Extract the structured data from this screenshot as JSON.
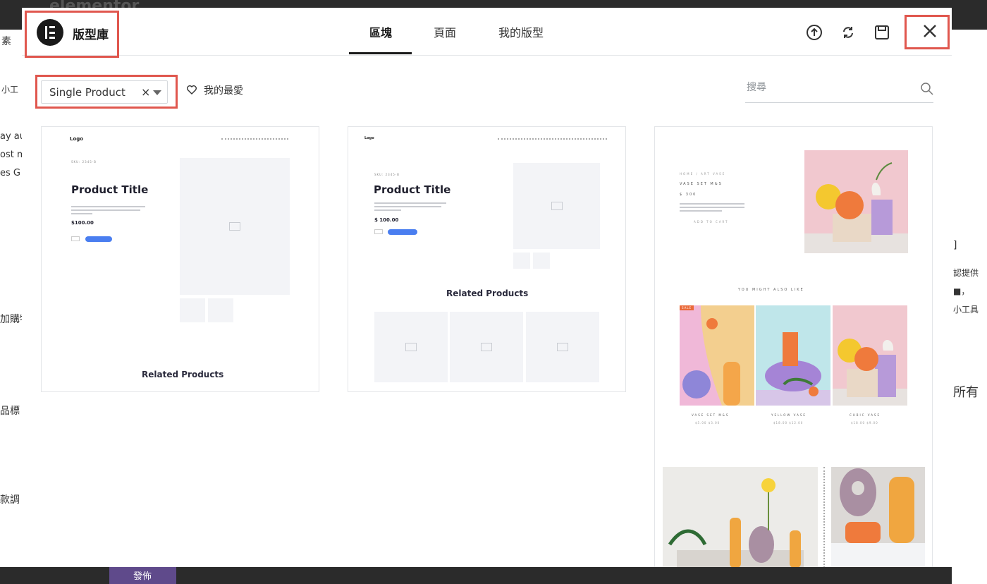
{
  "background": {
    "editor_brand": "elementor",
    "left_fragments": [
      "素",
      "小工",
      "ay au",
      "ost m",
      "es G",
      "加購物",
      "品標",
      "款調"
    ],
    "right_fragments": [
      "]",
      "認提供",
      "■，",
      "小工具",
      "所有"
    ],
    "publish_label": "發佈"
  },
  "modal": {
    "title": "版型庫",
    "tabs": [
      {
        "label": "區塊",
        "active": true
      },
      {
        "label": "頁面",
        "active": false
      },
      {
        "label": "我的版型",
        "active": false
      }
    ],
    "header_icons": [
      "upload-icon",
      "sync-icon",
      "save-icon",
      "close-icon"
    ],
    "filter": {
      "selected": "Single Product"
    },
    "favorites_label": "我的最愛",
    "search": {
      "placeholder": "搜尋"
    }
  },
  "templates": [
    {
      "logo": "Logo",
      "category": "SKU: 2345-B",
      "title": "Product Title",
      "price": "$100.00",
      "related": "Related Products"
    },
    {
      "logo": "Logo",
      "category": "SKU: 2345-B",
      "title": "Product Title",
      "price": "$ 100.00",
      "related": "Related Products"
    },
    {
      "kicker": "HOME / ART VASE",
      "title": "VASE SET M&S",
      "price": "$ 300",
      "also_like": "YOU MIGHT ALSO LIKE",
      "sale_badge": "SALE",
      "products": [
        {
          "name": "VASE SET M&S",
          "price": "$5.00 $3.00"
        },
        {
          "name": "YELLOW VASE",
          "price": "$18.00 $12.00"
        },
        {
          "name": "CUBIC VASE",
          "price": "$18.00 $9.00"
        }
      ],
      "add_to_cart": "ADD TO CART"
    }
  ],
  "colors": {
    "highlight": "#e0574e",
    "cta_blue": "#4a7ef0",
    "dark": "#1a1a1a"
  }
}
